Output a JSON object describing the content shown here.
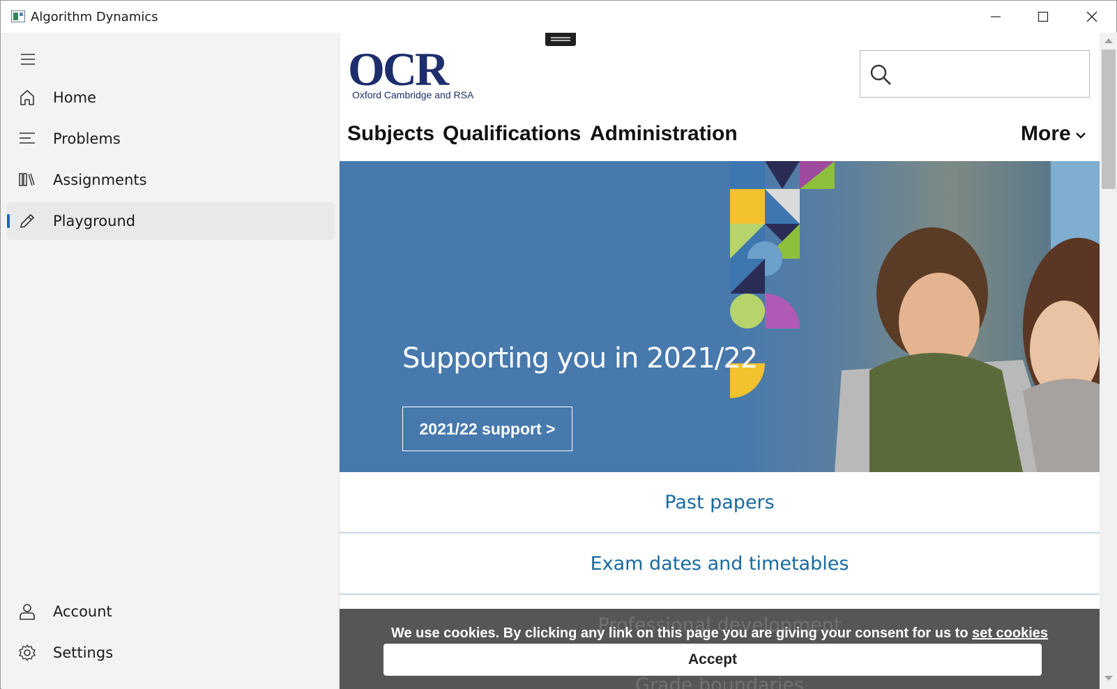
{
  "window": {
    "title": "Algorithm Dynamics",
    "app_icon": "app-window-icon",
    "controls": [
      "minimize-icon",
      "maximize-icon",
      "close-icon"
    ]
  },
  "sidebar": {
    "menu_icon": "hamburger-icon",
    "items": [
      {
        "label": "Home",
        "icon": "home-icon",
        "active": false
      },
      {
        "label": "Problems",
        "icon": "list-icon",
        "active": false
      },
      {
        "label": "Assignments",
        "icon": "library-icon",
        "active": false
      },
      {
        "label": "Playground",
        "icon": "pencil-icon",
        "active": true
      }
    ],
    "footer_items": [
      {
        "label": "Account",
        "icon": "person-icon"
      },
      {
        "label": "Settings",
        "icon": "gear-icon"
      }
    ],
    "accent_color": "#1a66c0"
  },
  "site": {
    "logo": {
      "text": "OCR",
      "subtitle": "Oxford Cambridge and RSA"
    },
    "search": {
      "placeholder": ""
    },
    "nav": [
      "Subjects",
      "Qualifications",
      "Administration"
    ],
    "more_label": "More",
    "hero": {
      "title": "Supporting you in 2021/22",
      "button_label": "2021/22 support >",
      "background_color": "#4779ad"
    },
    "quick_links": [
      "Past papers",
      "Exam dates and timetables",
      "Professional development",
      "Grade boundaries"
    ],
    "link_color": "#186aa3"
  },
  "cookie_banner": {
    "text": "We use cookies. By clicking any link on this page you are giving your consent for us to ",
    "link_text": "set cookies",
    "accept_label": "Accept"
  }
}
